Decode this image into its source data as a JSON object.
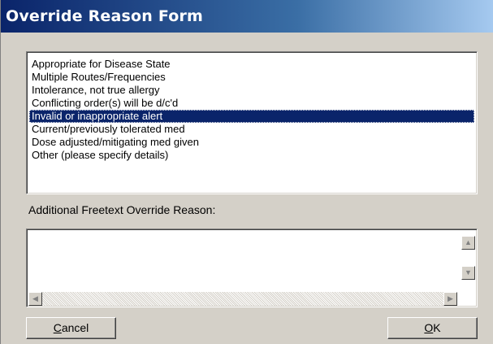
{
  "window": {
    "title": "Override Reason Form"
  },
  "reasons": {
    "items": [
      "Appropriate for Disease State",
      "Multiple Routes/Frequencies",
      "Intolerance, not true allergy",
      "Conflicting order(s) will be d/c'd",
      "Invalid or inappropriate alert",
      "Current/previously tolerated med",
      "Dose adjusted/mitigating med given",
      "Other (please specify details)"
    ],
    "selected": "Invalid or inappropriate alert"
  },
  "freetext": {
    "label": "Additional Freetext Override Reason:",
    "value": ""
  },
  "buttons": {
    "cancel": {
      "mnemonic": "C",
      "rest": "ancel"
    },
    "ok": {
      "mnemonic": "O",
      "rest": "K"
    }
  },
  "colors": {
    "selection": "#0a246a",
    "title_start": "#0a246a",
    "title_end": "#a6caf0",
    "face": "#d4d0c8"
  }
}
